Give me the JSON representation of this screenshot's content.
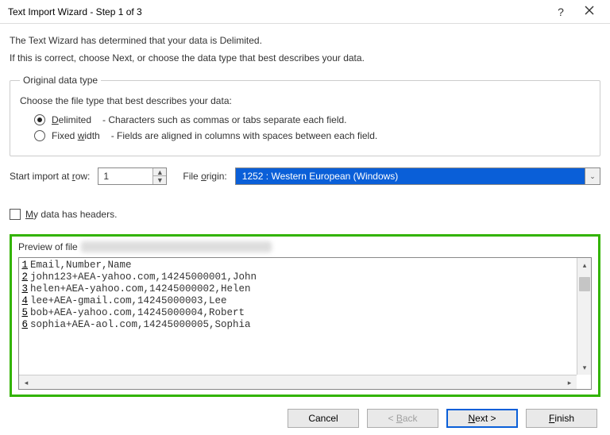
{
  "title": "Text Import Wizard - Step 1 of 3",
  "intro": {
    "line1": "The Text Wizard has determined that your data is Delimited.",
    "line2": "If this is correct, choose Next, or choose the data type that best describes your data."
  },
  "original_data": {
    "legend": "Original data type",
    "choose": "Choose the file type that best describes your data:",
    "delimited": {
      "label_pre": "",
      "label_u": "D",
      "label_post": "elimited",
      "desc": "- Characters such as commas or tabs separate each field."
    },
    "fixedwidth": {
      "label_pre": "Fixed ",
      "label_u": "w",
      "label_post": "idth",
      "desc": "- Fields are aligned in columns with spaces between each field."
    }
  },
  "start_row": {
    "label_pre": "Start import at ",
    "label_u": "r",
    "label_post": "ow:",
    "value": "1"
  },
  "file_origin": {
    "label_pre": "File ",
    "label_u": "o",
    "label_post": "rigin:",
    "value": "1252 : Western European (Windows)"
  },
  "headers_checkbox": {
    "label_u": "M",
    "label_post": "y data has headers."
  },
  "preview": {
    "label": "Preview of file",
    "rows": [
      {
        "n": "1",
        "text": "Email,Number,Name"
      },
      {
        "n": "2",
        "text": "john123+AEA-yahoo.com,14245000001,John"
      },
      {
        "n": "3",
        "text": "helen+AEA-yahoo.com,14245000002,Helen"
      },
      {
        "n": "4",
        "text": "lee+AEA-gmail.com,14245000003,Lee"
      },
      {
        "n": "5",
        "text": "bob+AEA-yahoo.com,14245000004,Robert"
      },
      {
        "n": "6",
        "text": "sophia+AEA-aol.com,14245000005,Sophia"
      }
    ]
  },
  "buttons": {
    "cancel": "Cancel",
    "back_lt": "<",
    "back_u": "B",
    "back_post": "ack",
    "next_u": "N",
    "next_post": "ext",
    "next_gt": ">",
    "finish_u": "F",
    "finish_post": "inish"
  }
}
